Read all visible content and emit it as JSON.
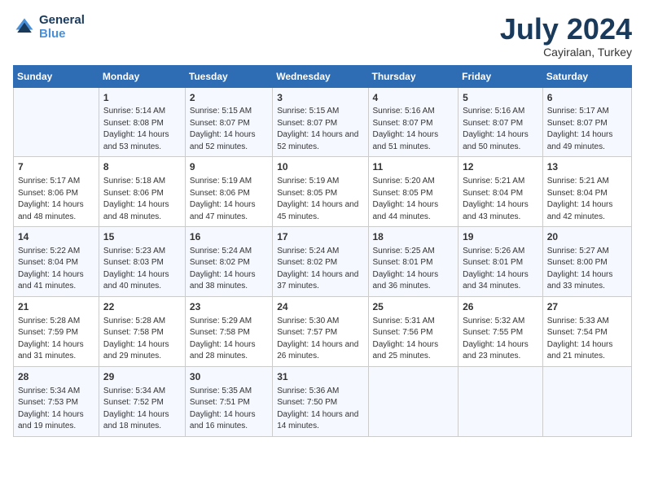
{
  "logo": {
    "line1": "General",
    "line2": "Blue"
  },
  "title": "July 2024",
  "subtitle": "Cayiralan, Turkey",
  "header_days": [
    "Sunday",
    "Monday",
    "Tuesday",
    "Wednesday",
    "Thursday",
    "Friday",
    "Saturday"
  ],
  "weeks": [
    [
      {
        "day": "",
        "sunrise": "",
        "sunset": "",
        "daylight": ""
      },
      {
        "day": "1",
        "sunrise": "Sunrise: 5:14 AM",
        "sunset": "Sunset: 8:08 PM",
        "daylight": "Daylight: 14 hours and 53 minutes."
      },
      {
        "day": "2",
        "sunrise": "Sunrise: 5:15 AM",
        "sunset": "Sunset: 8:07 PM",
        "daylight": "Daylight: 14 hours and 52 minutes."
      },
      {
        "day": "3",
        "sunrise": "Sunrise: 5:15 AM",
        "sunset": "Sunset: 8:07 PM",
        "daylight": "Daylight: 14 hours and 52 minutes."
      },
      {
        "day": "4",
        "sunrise": "Sunrise: 5:16 AM",
        "sunset": "Sunset: 8:07 PM",
        "daylight": "Daylight: 14 hours and 51 minutes."
      },
      {
        "day": "5",
        "sunrise": "Sunrise: 5:16 AM",
        "sunset": "Sunset: 8:07 PM",
        "daylight": "Daylight: 14 hours and 50 minutes."
      },
      {
        "day": "6",
        "sunrise": "Sunrise: 5:17 AM",
        "sunset": "Sunset: 8:07 PM",
        "daylight": "Daylight: 14 hours and 49 minutes."
      }
    ],
    [
      {
        "day": "7",
        "sunrise": "Sunrise: 5:17 AM",
        "sunset": "Sunset: 8:06 PM",
        "daylight": "Daylight: 14 hours and 48 minutes."
      },
      {
        "day": "8",
        "sunrise": "Sunrise: 5:18 AM",
        "sunset": "Sunset: 8:06 PM",
        "daylight": "Daylight: 14 hours and 48 minutes."
      },
      {
        "day": "9",
        "sunrise": "Sunrise: 5:19 AM",
        "sunset": "Sunset: 8:06 PM",
        "daylight": "Daylight: 14 hours and 47 minutes."
      },
      {
        "day": "10",
        "sunrise": "Sunrise: 5:19 AM",
        "sunset": "Sunset: 8:05 PM",
        "daylight": "Daylight: 14 hours and 45 minutes."
      },
      {
        "day": "11",
        "sunrise": "Sunrise: 5:20 AM",
        "sunset": "Sunset: 8:05 PM",
        "daylight": "Daylight: 14 hours and 44 minutes."
      },
      {
        "day": "12",
        "sunrise": "Sunrise: 5:21 AM",
        "sunset": "Sunset: 8:04 PM",
        "daylight": "Daylight: 14 hours and 43 minutes."
      },
      {
        "day": "13",
        "sunrise": "Sunrise: 5:21 AM",
        "sunset": "Sunset: 8:04 PM",
        "daylight": "Daylight: 14 hours and 42 minutes."
      }
    ],
    [
      {
        "day": "14",
        "sunrise": "Sunrise: 5:22 AM",
        "sunset": "Sunset: 8:04 PM",
        "daylight": "Daylight: 14 hours and 41 minutes."
      },
      {
        "day": "15",
        "sunrise": "Sunrise: 5:23 AM",
        "sunset": "Sunset: 8:03 PM",
        "daylight": "Daylight: 14 hours and 40 minutes."
      },
      {
        "day": "16",
        "sunrise": "Sunrise: 5:24 AM",
        "sunset": "Sunset: 8:02 PM",
        "daylight": "Daylight: 14 hours and 38 minutes."
      },
      {
        "day": "17",
        "sunrise": "Sunrise: 5:24 AM",
        "sunset": "Sunset: 8:02 PM",
        "daylight": "Daylight: 14 hours and 37 minutes."
      },
      {
        "day": "18",
        "sunrise": "Sunrise: 5:25 AM",
        "sunset": "Sunset: 8:01 PM",
        "daylight": "Daylight: 14 hours and 36 minutes."
      },
      {
        "day": "19",
        "sunrise": "Sunrise: 5:26 AM",
        "sunset": "Sunset: 8:01 PM",
        "daylight": "Daylight: 14 hours and 34 minutes."
      },
      {
        "day": "20",
        "sunrise": "Sunrise: 5:27 AM",
        "sunset": "Sunset: 8:00 PM",
        "daylight": "Daylight: 14 hours and 33 minutes."
      }
    ],
    [
      {
        "day": "21",
        "sunrise": "Sunrise: 5:28 AM",
        "sunset": "Sunset: 7:59 PM",
        "daylight": "Daylight: 14 hours and 31 minutes."
      },
      {
        "day": "22",
        "sunrise": "Sunrise: 5:28 AM",
        "sunset": "Sunset: 7:58 PM",
        "daylight": "Daylight: 14 hours and 29 minutes."
      },
      {
        "day": "23",
        "sunrise": "Sunrise: 5:29 AM",
        "sunset": "Sunset: 7:58 PM",
        "daylight": "Daylight: 14 hours and 28 minutes."
      },
      {
        "day": "24",
        "sunrise": "Sunrise: 5:30 AM",
        "sunset": "Sunset: 7:57 PM",
        "daylight": "Daylight: 14 hours and 26 minutes."
      },
      {
        "day": "25",
        "sunrise": "Sunrise: 5:31 AM",
        "sunset": "Sunset: 7:56 PM",
        "daylight": "Daylight: 14 hours and 25 minutes."
      },
      {
        "day": "26",
        "sunrise": "Sunrise: 5:32 AM",
        "sunset": "Sunset: 7:55 PM",
        "daylight": "Daylight: 14 hours and 23 minutes."
      },
      {
        "day": "27",
        "sunrise": "Sunrise: 5:33 AM",
        "sunset": "Sunset: 7:54 PM",
        "daylight": "Daylight: 14 hours and 21 minutes."
      }
    ],
    [
      {
        "day": "28",
        "sunrise": "Sunrise: 5:34 AM",
        "sunset": "Sunset: 7:53 PM",
        "daylight": "Daylight: 14 hours and 19 minutes."
      },
      {
        "day": "29",
        "sunrise": "Sunrise: 5:34 AM",
        "sunset": "Sunset: 7:52 PM",
        "daylight": "Daylight: 14 hours and 18 minutes."
      },
      {
        "day": "30",
        "sunrise": "Sunrise: 5:35 AM",
        "sunset": "Sunset: 7:51 PM",
        "daylight": "Daylight: 14 hours and 16 minutes."
      },
      {
        "day": "31",
        "sunrise": "Sunrise: 5:36 AM",
        "sunset": "Sunset: 7:50 PM",
        "daylight": "Daylight: 14 hours and 14 minutes."
      },
      {
        "day": "",
        "sunrise": "",
        "sunset": "",
        "daylight": ""
      },
      {
        "day": "",
        "sunrise": "",
        "sunset": "",
        "daylight": ""
      },
      {
        "day": "",
        "sunrise": "",
        "sunset": "",
        "daylight": ""
      }
    ]
  ]
}
